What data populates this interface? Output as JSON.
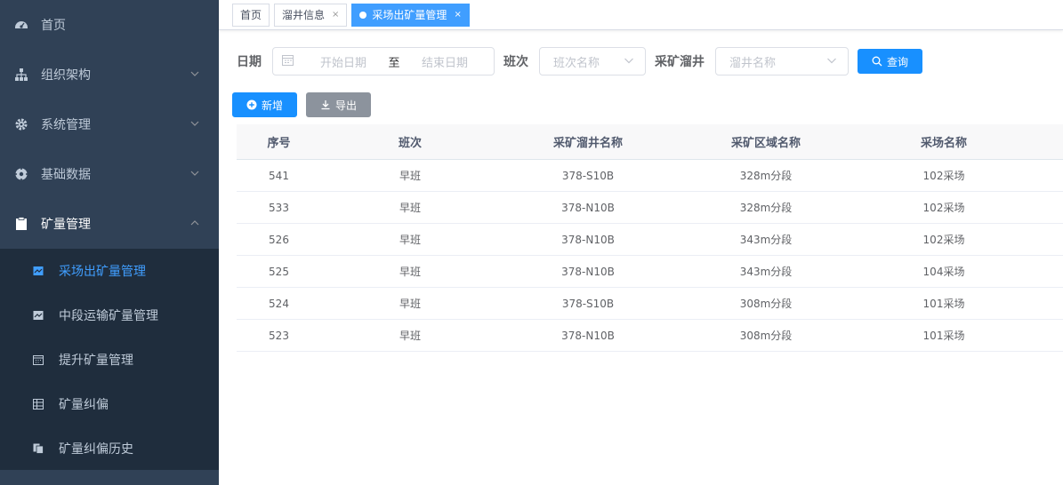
{
  "sidebar": {
    "menu": [
      {
        "label": "首页",
        "icon": "dashboard-icon"
      },
      {
        "label": "组织架构",
        "icon": "org-tree-icon"
      },
      {
        "label": "系统管理",
        "icon": "gear-icon"
      },
      {
        "label": "基础数据",
        "icon": "compass-icon"
      },
      {
        "label": "矿量管理",
        "icon": "clipboard-icon"
      }
    ],
    "submenu": [
      {
        "label": "采场出矿量管理",
        "icon": "chart-icon"
      },
      {
        "label": "中段运输矿量管理",
        "icon": "chart-icon"
      },
      {
        "label": "提升矿量管理",
        "icon": "calendar-icon"
      },
      {
        "label": "矿量纠偏",
        "icon": "grid-icon"
      },
      {
        "label": "矿量纠偏历史",
        "icon": "copy-icon"
      }
    ]
  },
  "tags": [
    {
      "label": "首页"
    },
    {
      "label": "溜井信息",
      "close": "×"
    },
    {
      "label": "采场出矿量管理",
      "close": "×"
    }
  ],
  "search": {
    "date_label": "日期",
    "date_start_placeholder": "开始日期",
    "date_separator": "至",
    "date_end_placeholder": "结束日期",
    "shift_label": "班次",
    "shift_placeholder": "班次名称",
    "chute_label": "采矿溜井",
    "chute_placeholder": "溜井名称",
    "query_button": "查询"
  },
  "toolbar": {
    "add_button": "新增",
    "export_button": "导出"
  },
  "table": {
    "columns": [
      "序号",
      "班次",
      "采矿溜井名称",
      "采矿区域名称",
      "采场名称"
    ],
    "rows": [
      [
        "541",
        "早班",
        "378-S10B",
        "328m分段",
        "102采场"
      ],
      [
        "533",
        "早班",
        "378-N10B",
        "328m分段",
        "102采场"
      ],
      [
        "526",
        "早班",
        "378-N10B",
        "343m分段",
        "102采场"
      ],
      [
        "525",
        "早班",
        "378-N10B",
        "343m分段",
        "104采场"
      ],
      [
        "524",
        "早班",
        "378-S10B",
        "308m分段",
        "101采场"
      ],
      [
        "523",
        "早班",
        "378-N10B",
        "308m分段",
        "101采场"
      ]
    ]
  }
}
